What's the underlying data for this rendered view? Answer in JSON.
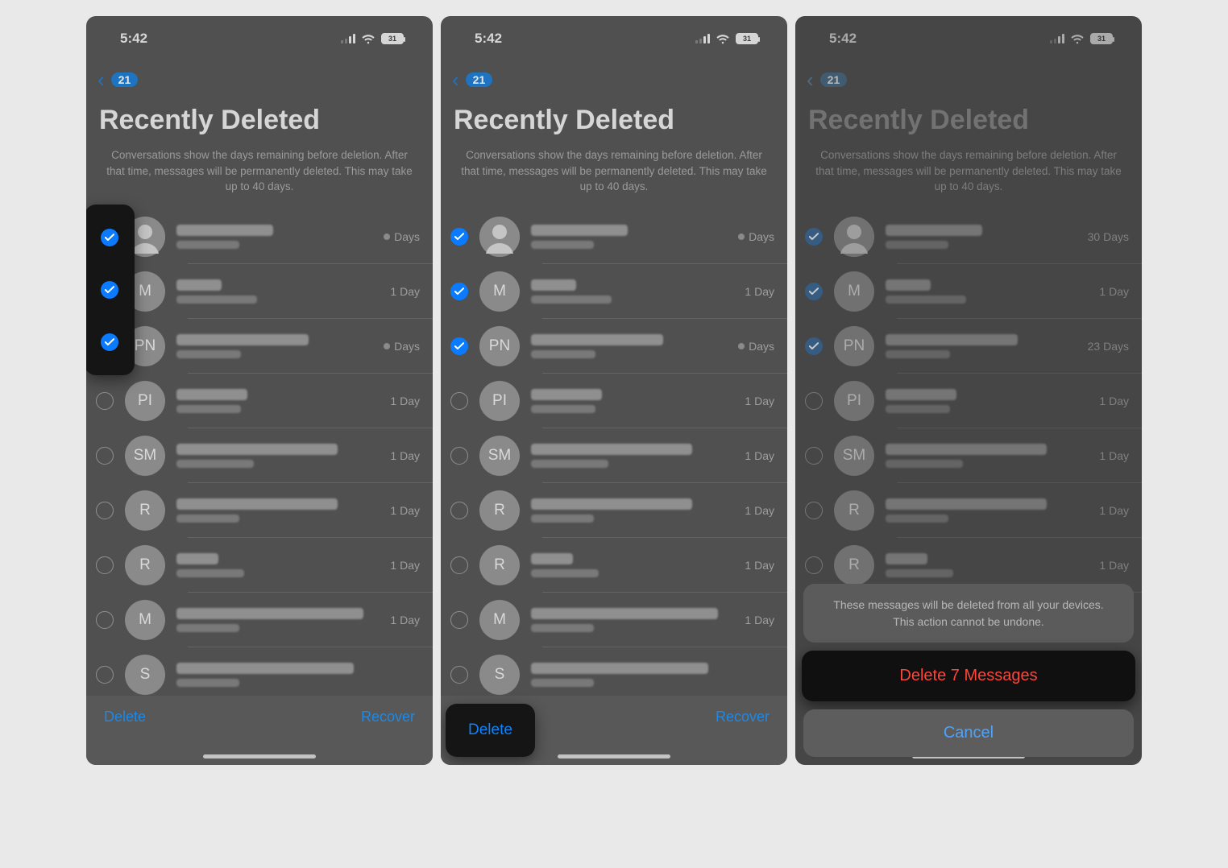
{
  "status": {
    "time": "5:42",
    "battery": "31"
  },
  "nav": {
    "back_badge": "21"
  },
  "page": {
    "title": "Recently Deleted",
    "subhead": "Conversations show the days remaining before deletion. After that time, messages will be permanently deleted. This may take up to 40 days."
  },
  "toolbar": {
    "delete": "Delete",
    "recover": "Recover"
  },
  "rows": [
    {
      "avatar_kind": "silhouette",
      "initials": "",
      "meta": "Days",
      "meta_dot": true,
      "name_w": 120,
      "sub_w": 78,
      "sel_p1": true,
      "sel_p2": true,
      "sel_p3": true
    },
    {
      "avatar_kind": "initials",
      "initials": "M",
      "meta": "1 Day",
      "meta_dot": false,
      "name_w": 56,
      "sub_w": 100,
      "sel_p1": true,
      "sel_p2": true,
      "sel_p3": true
    },
    {
      "avatar_kind": "initials",
      "initials": "PN",
      "meta": "Days",
      "meta_dot": true,
      "name_w": 164,
      "sub_w": 80,
      "sel_p1": true,
      "sel_p2": true,
      "sel_p3": true
    },
    {
      "avatar_kind": "initials",
      "initials": "PI",
      "meta": "1 Day",
      "meta_dot": false,
      "name_w": 88,
      "sub_w": 80,
      "sel_p1": false,
      "sel_p2": false,
      "sel_p3": false
    },
    {
      "avatar_kind": "initials",
      "initials": "SM",
      "meta": "1 Day",
      "meta_dot": false,
      "name_w": 200,
      "sub_w": 96,
      "sel_p1": false,
      "sel_p2": false,
      "sel_p3": false
    },
    {
      "avatar_kind": "initials",
      "initials": "R",
      "meta": "1 Day",
      "meta_dot": false,
      "name_w": 200,
      "sub_w": 78,
      "sel_p1": false,
      "sel_p2": false,
      "sel_p3": false
    },
    {
      "avatar_kind": "initials",
      "initials": "R",
      "meta": "1 Day",
      "meta_dot": false,
      "name_w": 52,
      "sub_w": 84,
      "sel_p1": false,
      "sel_p2": false,
      "sel_p3": false
    },
    {
      "avatar_kind": "initials",
      "initials": "M",
      "meta": "1 Day",
      "meta_dot": false,
      "name_w": 232,
      "sub_w": 78,
      "sel_p1": false,
      "sel_p2": false,
      "sel_p3": false
    },
    {
      "avatar_kind": "initials",
      "initials": "S",
      "meta": "",
      "meta_dot": false,
      "name_w": 220,
      "sub_w": 78,
      "sel_p1": false,
      "sel_p2": false,
      "sel_p3": false
    }
  ],
  "rows_p3_meta": [
    "30 Days",
    "1 Day",
    "23 Days",
    "1 Day",
    "1 Day",
    "1 Day",
    "1 Day"
  ],
  "sheet": {
    "message": "These messages will be deleted from all your devices. This action cannot be undone.",
    "delete": "Delete 7 Messages",
    "cancel": "Cancel"
  }
}
